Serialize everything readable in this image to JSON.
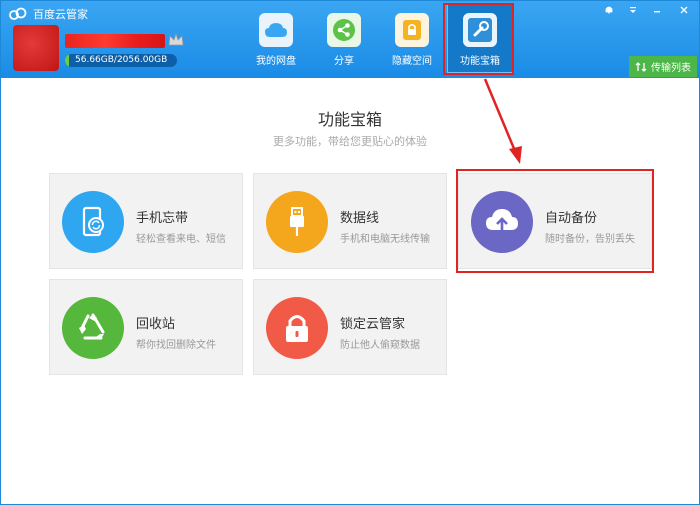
{
  "app": {
    "title": "百度云管家",
    "storage_text": "56.66GB/2056.00GB",
    "storage_used": 56.66,
    "storage_total": 2056.0
  },
  "nav": {
    "items": [
      {
        "label": "我的网盘",
        "icon": "cloud-icon",
        "color": "#3aa6f2"
      },
      {
        "label": "分享",
        "icon": "share-icon",
        "color": "#5cc24a"
      },
      {
        "label": "隐藏空间",
        "icon": "lock-icon",
        "color": "#f5b324"
      },
      {
        "label": "功能宝箱",
        "icon": "toolbox-icon",
        "color": "#2f8fd8"
      }
    ],
    "active_index": 3
  },
  "toolbar": {
    "transfer_label": "传输列表"
  },
  "page": {
    "title": "功能宝箱",
    "subtitle": "更多功能，带给您更贴心的体验"
  },
  "cards": [
    {
      "title": "手机忘带",
      "desc": "轻松查看来电、短信",
      "icon": "phone-sync-icon",
      "color": "#2fa6f0"
    },
    {
      "title": "数据线",
      "desc": "手机和电脑无线传输",
      "icon": "usb-icon",
      "color": "#f4a61d"
    },
    {
      "title": "自动备份",
      "desc": "随时备份，告别丢失",
      "icon": "cloud-upload-icon",
      "color": "#6b67c4"
    },
    {
      "title": "回收站",
      "desc": "帮你找回删除文件",
      "icon": "recycle-icon",
      "color": "#55b73b"
    },
    {
      "title": "锁定云管家",
      "desc": "防止他人偷窥数据",
      "icon": "padlock-icon",
      "color": "#f05a46"
    }
  ],
  "colors": {
    "header": "#1a8be6",
    "highlight": "#e02424",
    "transfer": "#4cb649"
  }
}
